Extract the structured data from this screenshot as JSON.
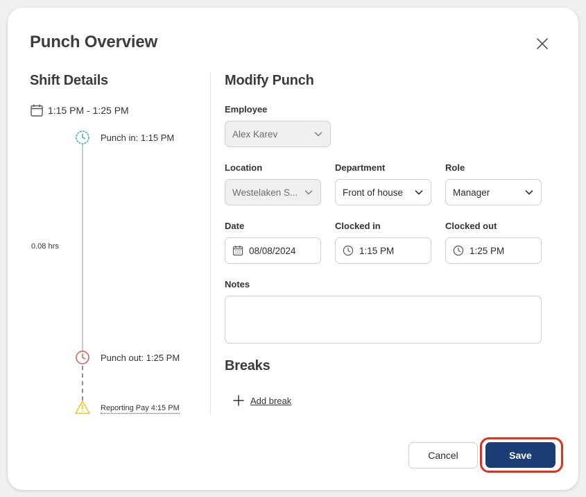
{
  "modal": {
    "title": "Punch Overview"
  },
  "shift": {
    "section_title": "Shift Details",
    "range": "1:15 PM - 1:25 PM",
    "punch_in": "Punch in: 1:15 PM",
    "duration": "0.08 hrs",
    "punch_out": "Punch out: 1:25 PM",
    "reporting_pay": "Reporting Pay 4:15 PM"
  },
  "modify": {
    "section_title": "Modify Punch",
    "employee": {
      "label": "Employee",
      "value": "Alex Karev"
    },
    "location": {
      "label": "Location",
      "value": "Westelaken S..."
    },
    "department": {
      "label": "Department",
      "value": "Front of house"
    },
    "role": {
      "label": "Role",
      "value": "Manager"
    },
    "date": {
      "label": "Date",
      "value": "08/08/2024"
    },
    "clocked_in": {
      "label": "Clocked in",
      "value": "1:15 PM"
    },
    "clocked_out": {
      "label": "Clocked out",
      "value": "1:25 PM"
    },
    "notes": {
      "label": "Notes",
      "value": ""
    }
  },
  "breaks": {
    "section_title": "Breaks",
    "add_label": "Add break"
  },
  "footer": {
    "cancel_label": "Cancel",
    "save_label": "Save"
  },
  "icons": {
    "close": "close-icon",
    "calendar": "calendar-icon",
    "clock": "clock-icon",
    "warning": "warning-icon",
    "chevron": "chevron-down-icon",
    "plus": "plus-icon"
  },
  "colors": {
    "primary": "#1b3e78",
    "highlight_ring": "#e0301e",
    "punch_in": "#2bb3a3",
    "punch_out": "#e05a4f",
    "warning": "#f0c419"
  }
}
